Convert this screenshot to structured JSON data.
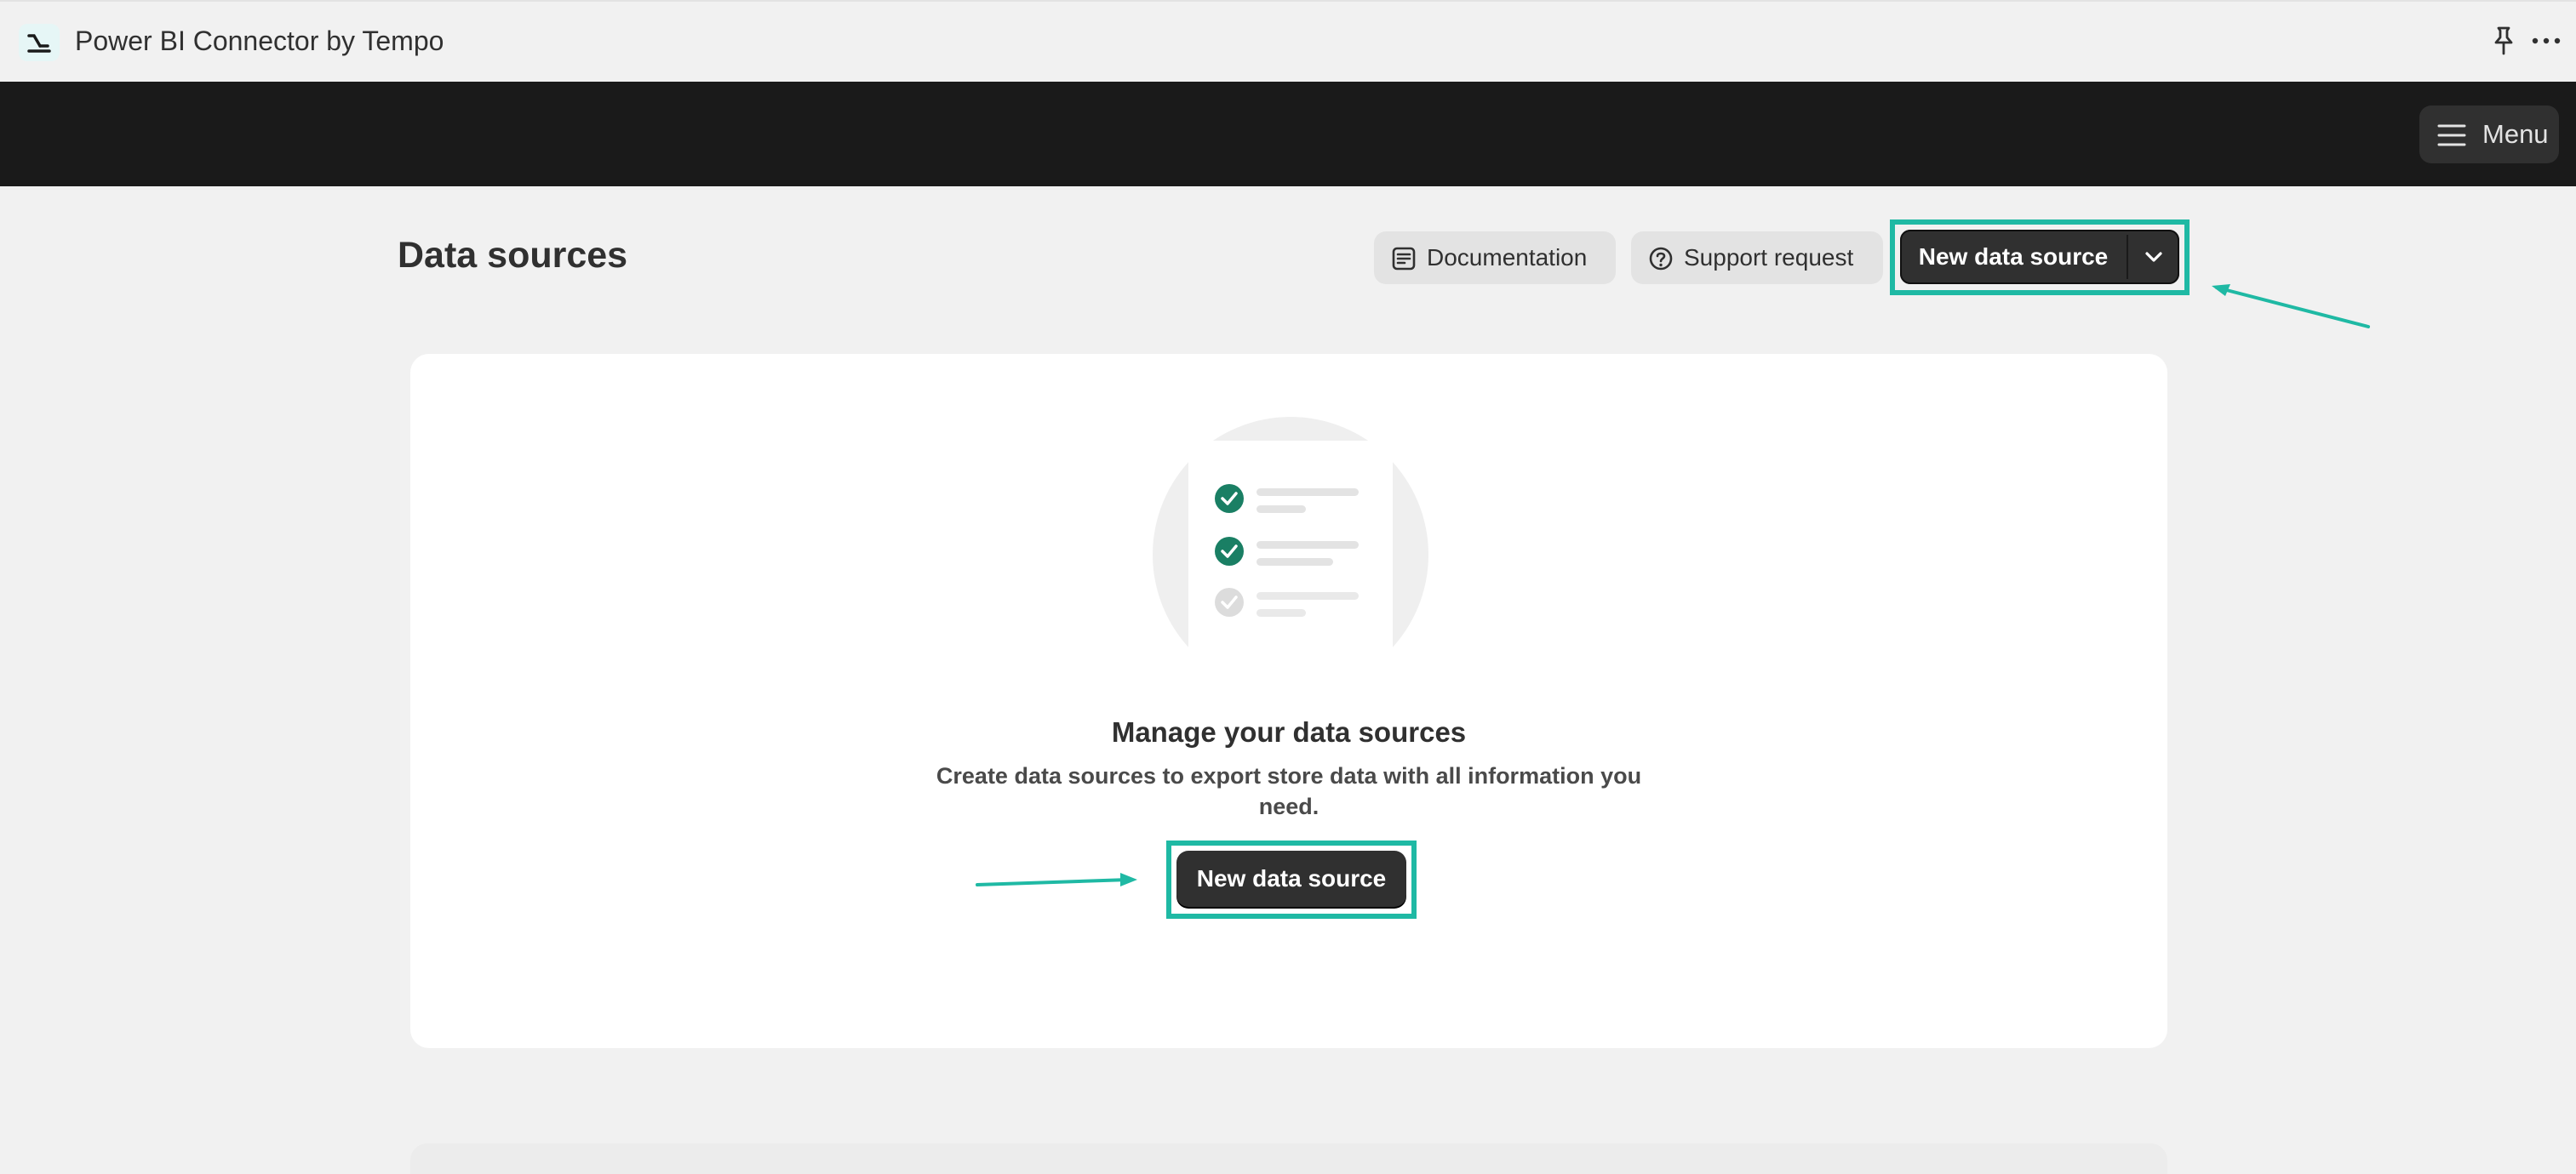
{
  "window": {
    "title": "Power BI Connector by Tempo",
    "app_icon": "tempo-logo-icon",
    "pin_icon": "pin-icon",
    "more_icon": "more-horizontal-icon"
  },
  "topbar": {
    "menu_label": "Menu",
    "menu_icon": "hamburger-icon"
  },
  "page": {
    "title": "Data sources",
    "actions": {
      "documentation_label": "Documentation",
      "support_label": "Support request",
      "new_data_source_label": "New data source"
    }
  },
  "empty_state": {
    "title": "Manage your data sources",
    "description": "Create data sources to export store data with all information you need.",
    "button_label": "New data source"
  },
  "colors": {
    "highlight": "#1fb9a4",
    "check_active": "#1a7f64",
    "check_inactive": "#d4d4d4",
    "primary_button": "#303030",
    "topbar": "#1a1a1a"
  }
}
